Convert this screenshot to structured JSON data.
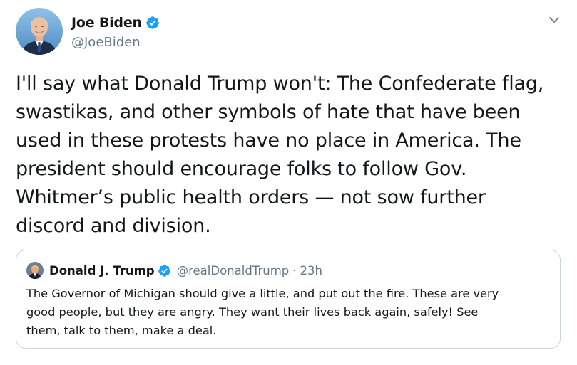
{
  "tweet": {
    "author": {
      "name": "Joe Biden",
      "handle": "@JoeBiden",
      "verified": true,
      "avatar_icon": "person-avatar-icon"
    },
    "menu_icon": "chevron-down-icon",
    "text": "I'll say what Donald Trump won't: The Confederate flag,\nswastikas, and other symbols of hate that have been\nused in these protests have no place in America. The\npresident should encourage folks to follow Gov.\nWhitmer’s public health orders — not sow further\ndiscord and division.",
    "quoted_tweet": {
      "author": {
        "name": "Donald J. Trump",
        "handle": "@realDonaldTrump",
        "verified": true,
        "avatar_icon": "person-avatar-icon"
      },
      "separator": "·",
      "time": "23h",
      "text": "The Governor of Michigan should give a little, and put out the fire. These are very\ngood people, but they are angry. They want their lives back again, safely! See\nthem, talk to them, make a deal."
    }
  },
  "colors": {
    "text_primary": "#14171a",
    "text_secondary": "#657786",
    "verified_blue": "#1da1f2",
    "border": "#ccd6dd"
  }
}
